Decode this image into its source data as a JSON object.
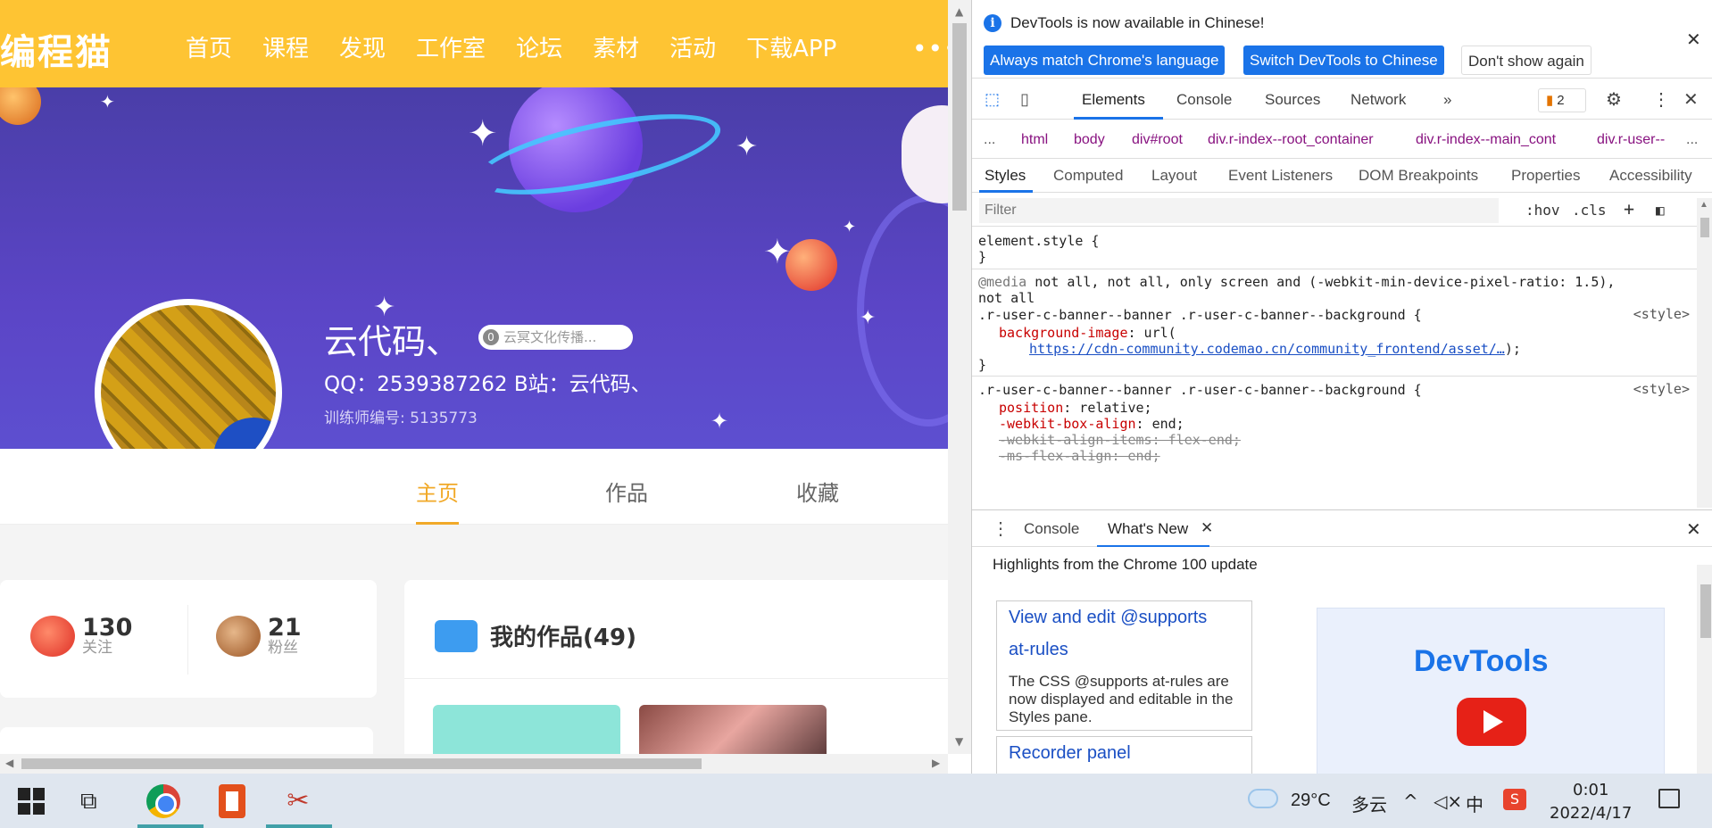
{
  "site": {
    "logo": "编程猫",
    "nav": [
      "首页",
      "课程",
      "发现",
      "工作室",
      "论坛",
      "素材",
      "活动",
      "下载APP"
    ],
    "nav_more": "•••"
  },
  "profile": {
    "username": "云代码、",
    "badge_count": "0",
    "badge_text": "云冥文化传播...",
    "description": "QQ：2539387262 B站：云代码、",
    "trainer": "训练师编号: 5135773"
  },
  "profile_tabs": {
    "home": "主页",
    "works": "作品",
    "favorites": "收藏"
  },
  "stats": {
    "following_count": "130",
    "following_label": "关注",
    "fans_count": "21",
    "fans_label": "粉丝"
  },
  "works": {
    "title": "我的作品(49)"
  },
  "devtools": {
    "notice": "DevTools is now available in Chinese!",
    "btn_match": "Always match Chrome's language",
    "btn_switch": "Switch DevTools to Chinese",
    "btn_dismiss": "Don't show again",
    "tabs": [
      "Elements",
      "Console",
      "Sources",
      "Network"
    ],
    "more_tabs": "»",
    "issues_count": "2",
    "breadcrumbs": [
      "...",
      "html",
      "body",
      "div#root",
      "div.r-index--root_container",
      "div.r-index--main_cont",
      "div.r-user--"
    ],
    "breadcrumbs_more": "...",
    "subtabs": [
      "Styles",
      "Computed",
      "Layout",
      "Event Listeners",
      "DOM Breakpoints",
      "Properties",
      "Accessibility"
    ],
    "filter_placeholder": "Filter",
    "hov": ":hov",
    "cls": ".cls",
    "plus": "+",
    "css": {
      "element_style": "element.style {",
      "close": "}",
      "media_kw": "@media",
      "media_rest": " not all, not all, only screen and (-webkit-min-device-pixel-ratio: 1.5),",
      "media_rest2": "not all",
      "selector": ".r-user-c-banner--banner .r-user-c-banner--background {",
      "source": "<style>",
      "bg_prop": "background-image",
      "bg_val": ": url(",
      "bg_url": "https://cdn-community.codemao.cn/community_frontend/asset/…",
      "bg_end": ");",
      "position_prop": "position",
      "position_val": ": relative;",
      "wb_prop": "-webkit-box-align",
      "wb_val": ": end;",
      "wai_prop": "-webkit-align-items",
      "wai_val": ": flex-end;",
      "ms_prop": "-ms-flex-align",
      "ms_val": ": end;"
    },
    "drawer_tabs": [
      "Console",
      "What's New"
    ],
    "whatsnew": {
      "heading": "Highlights from the Chrome 100 update",
      "card1_title": "View and edit @supports",
      "card1_title2": "at-rules",
      "card1_body": "The CSS @supports at-rules are now displayed and editable in the Styles pane.",
      "card2_title": "Recorder panel",
      "image_logo": "DevTools"
    }
  },
  "taskbar": {
    "temperature": "29°C",
    "weather": "多云",
    "ime": "中",
    "time": "0:01",
    "date": "2022/4/17"
  },
  "colors": {
    "brand_yellow": "#fec433",
    "banner_purple": "#5b45c6",
    "tab_active": "#f1a928",
    "devtools_blue": "#1a73e8"
  }
}
